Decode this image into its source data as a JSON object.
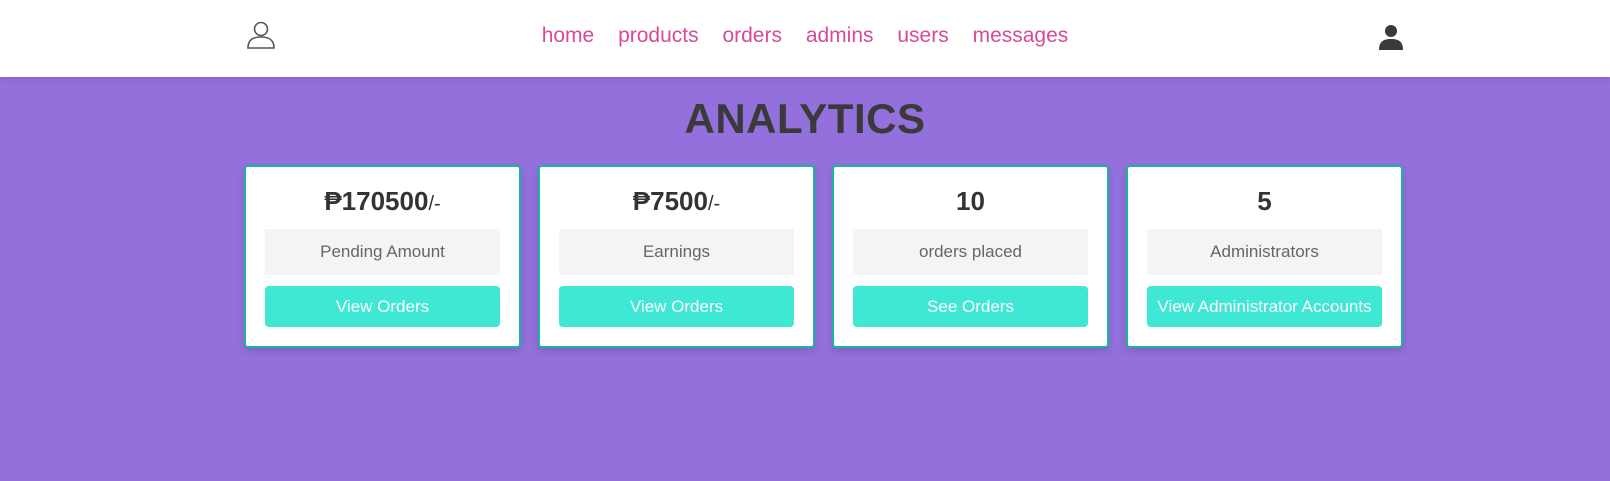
{
  "header": {
    "logo_icon": "user-outline-icon",
    "nav": [
      {
        "label": "home"
      },
      {
        "label": "products"
      },
      {
        "label": "orders"
      },
      {
        "label": "admins"
      },
      {
        "label": "users"
      },
      {
        "label": "messages"
      }
    ],
    "account_icon": "user-solid-icon"
  },
  "page": {
    "title": "ANALYTICS"
  },
  "cards": [
    {
      "value": "₱170500",
      "suffix": "/-",
      "label": "Pending Amount",
      "button": "View Orders"
    },
    {
      "value": "₱7500",
      "suffix": "/-",
      "label": "Earnings",
      "button": "View Orders"
    },
    {
      "value": "10",
      "suffix": "",
      "label": "orders placed",
      "button": "See Orders"
    },
    {
      "value": "5",
      "suffix": "",
      "label": "Administrators",
      "button": "View Administrator Accounts"
    }
  ],
  "colors": {
    "background": "#9370db",
    "nav_link": "#d84a97",
    "button": "#3ee8d4",
    "card_border": "#17b5a5"
  }
}
